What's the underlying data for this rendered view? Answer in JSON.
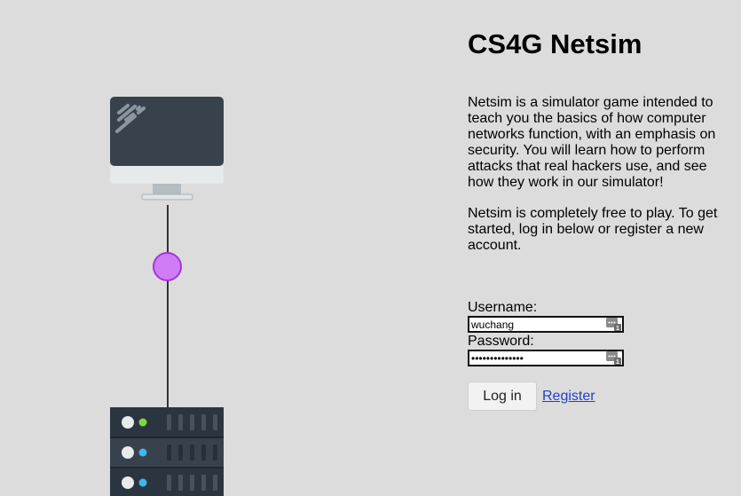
{
  "header": {
    "title": "CS4G Netsim"
  },
  "intro": {
    "paragraph_1": "Netsim is a simulator game intended to teach you the basics of how computer networks function, with an emphasis on security. You will learn how to perform attacks that real hackers use, and see how they work in our simulator!",
    "paragraph_2": "Netsim is completely free to play. To get started, log in below or register a new account."
  },
  "login": {
    "username_label": "Username:",
    "username_value": "wuchang",
    "password_label": "Password:",
    "password_value": "••••••••••••••",
    "login_button": "Log in",
    "register_link": "Register"
  },
  "illustration": {
    "monitor_icon": "computer-monitor-icon",
    "packet_icon": "packet-node-icon",
    "server_icon": "server-rack-icon",
    "packet_color": "#d07cf5",
    "monitor_screen_color": "#37424d",
    "server_color": "#2b3540"
  },
  "colors": {
    "background": "#dcdcdc",
    "link": "#2440c8"
  }
}
